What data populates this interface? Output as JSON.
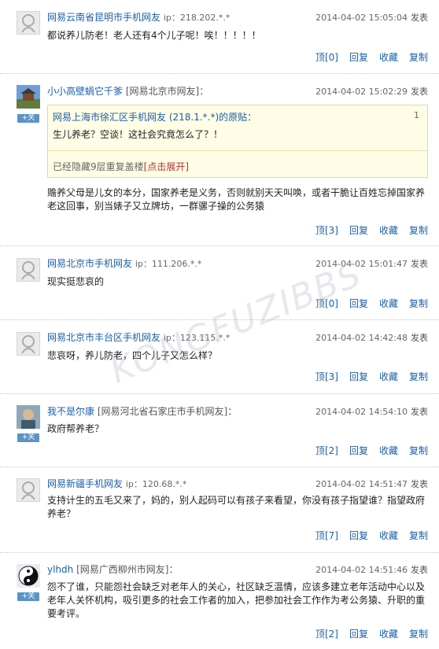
{
  "comments": [
    {
      "user": "网易云南省昆明市手机网友",
      "ip": "ip：218.202.*.*",
      "time": "2014-04-02 15:05:04",
      "post_label": "发表",
      "text": "都说养儿防老！老人还有4个儿子呢！唉！！！！！",
      "votes": "0"
    },
    {
      "user": "小小高壁蝸它千爹",
      "source": "[网易北京市网友]：",
      "follow_label": "+关",
      "time": "2014-04-02 15:02:29",
      "post_label": "发表",
      "quote": {
        "header": "网易上海市徐汇区手机网友 (218.1.*.*)的原贴：",
        "floor": "1",
        "text": "生儿养老？空谈！这社会究竟怎么了？！",
        "hidden_prefix": "已经隐藏9层重复盖楼",
        "expand_label": "[点击展开]"
      },
      "text": "赡养父母是儿女的本分，国家养老是义务，否则就别天天叫唤，或者干脆让百姓忘掉国家养老这回事，别当婊子又立牌坊，一群骡子操的公务猿",
      "votes": "3"
    },
    {
      "user": "网易北京市手机网友",
      "ip": "ip：111.206.*.*",
      "time": "2014-04-02 15:01:47",
      "post_label": "发表",
      "text": "现实挺悲哀的",
      "votes": "0"
    },
    {
      "user": "网易北京市丰台区手机网友",
      "ip": "ip：123.115.*.*",
      "time": "2014-04-02 14:42:48",
      "post_label": "发表",
      "text": "悲哀呀，养儿防老，四个儿子又怎么样？",
      "votes": "3"
    },
    {
      "user": "我不是尔康",
      "source": "[网易河北省石家庄市手机网友]：",
      "follow_label": "+关",
      "time": "2014-04-02 14:54:10",
      "post_label": "发表",
      "text": "政府帮养老？",
      "votes": "2"
    },
    {
      "user": "网易新疆手机网友",
      "ip": "ip：120.68.*.*",
      "time": "2014-04-02 14:51:47",
      "post_label": "发表",
      "text": "支持计生的五毛又来了，妈的，别人起码可以有孩子来看望，你没有孩子指望谁？指望政府养老？",
      "votes": "7"
    },
    {
      "user": "ylhdh",
      "source": "[网易广西柳州市网友]：",
      "follow_label": "+关",
      "time": "2014-04-02 14:51:46",
      "post_label": "发表",
      "text": "怨不了谁，只能怨社会缺乏对老年人的关心，社区缺乏温情，应该多建立老年活动中心以及老年人关怀机构，吸引更多的社会工作者的加入，把参加社会工作作为考公务猿、升职的重要考评。",
      "votes": "2"
    }
  ],
  "actions": {
    "vote_prefix": "顶",
    "reply": "回复",
    "favorite": "收藏",
    "copy": "复制"
  },
  "watermark": "KONGFUZIBBS"
}
